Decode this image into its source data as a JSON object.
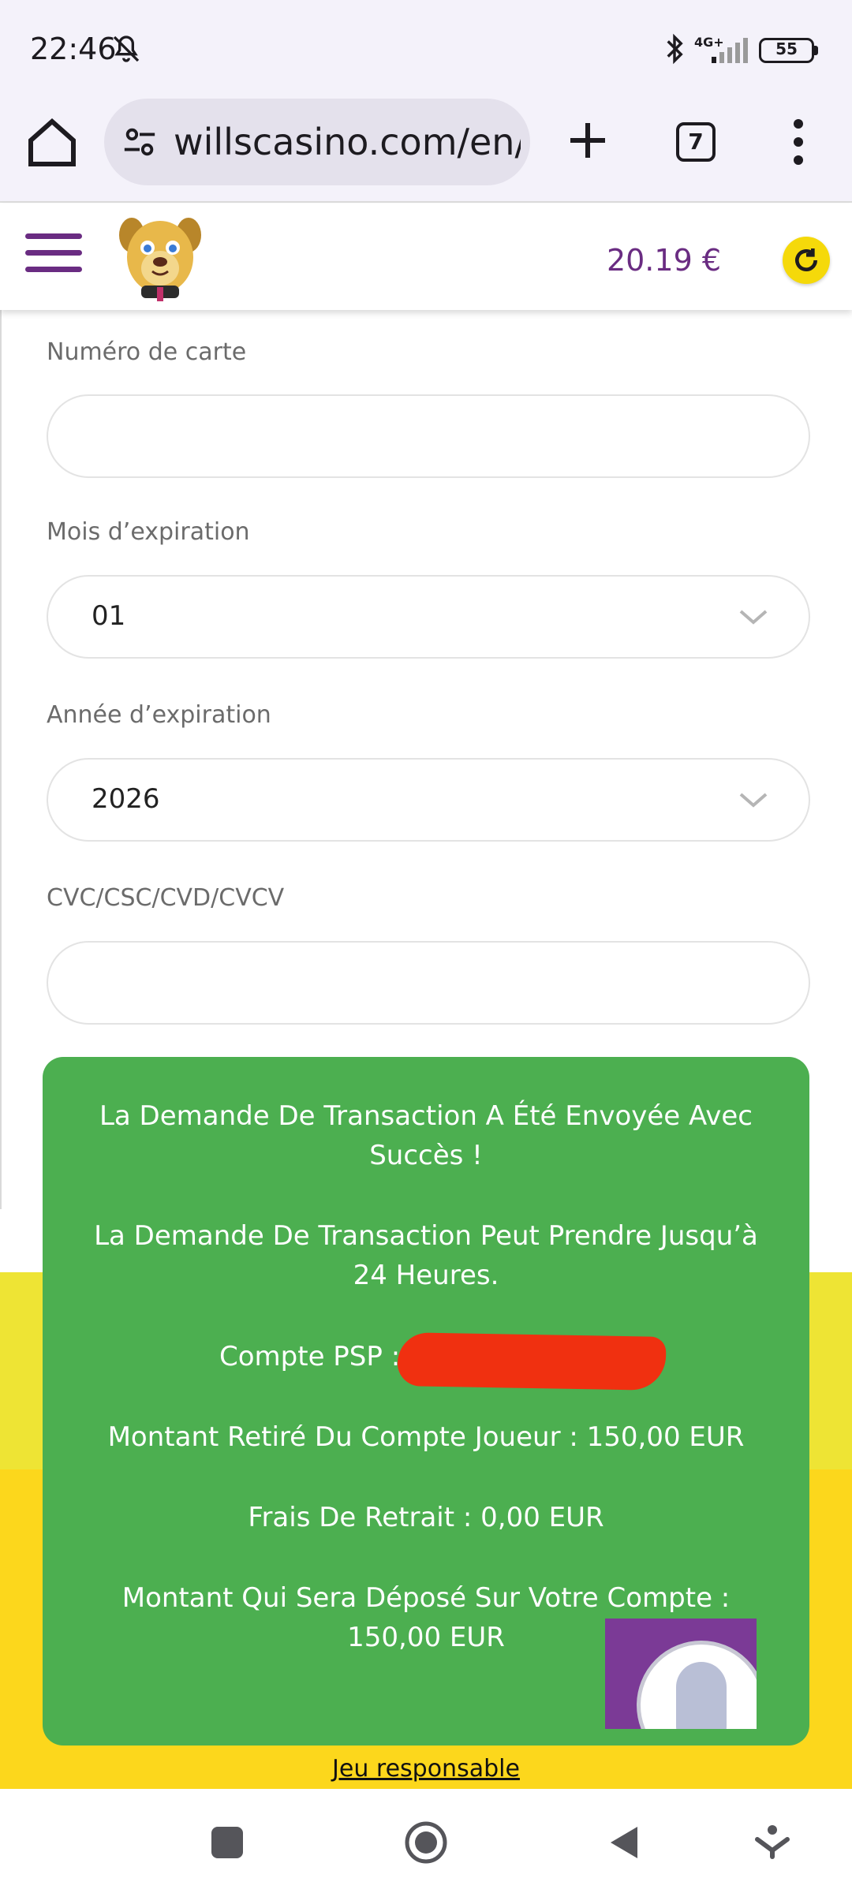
{
  "status_bar": {
    "time": "22:46",
    "network": "4G+",
    "battery": "55",
    "icons": [
      "bell-off-icon",
      "bluetooth-icon",
      "signal-icon",
      "battery-icon"
    ]
  },
  "browser": {
    "url": "willscasino.com/en/c",
    "tab_count": "7",
    "icons": [
      "home-icon",
      "site-settings-icon",
      "plus-icon",
      "more-vert-icon"
    ]
  },
  "header": {
    "balance": "20.19 €",
    "icons": [
      "hamburger-icon",
      "dog-logo",
      "refresh-icon"
    ],
    "colors": {
      "brand_purple": "#6a2c82",
      "refresh_yellow": "#f5d90a"
    }
  },
  "form": {
    "card_number": {
      "label": "Numéro de carte",
      "value": ""
    },
    "expiry_month": {
      "label": "Mois d’expiration",
      "value": "01"
    },
    "expiry_year": {
      "label": "Année d’expiration",
      "value": "2026"
    },
    "cvc": {
      "label": "CVC/CSC/CVD/CVCV",
      "value": ""
    }
  },
  "popup": {
    "line1": "La Demande De Transaction A Été Envoyée Avec Succès !",
    "line2": "La Demande De Transaction Peut Prendre Jusqu’à 24 Heures.",
    "psp_label": "Compte PSP :",
    "withdrawn": "Montant Retiré Du Compte Joueur : 150,00 EUR",
    "fees": "Frais De Retrait : 0,00 EUR",
    "deposit": "Montant Qui Sera Déposé Sur Votre Compte : 150,00 EUR",
    "color": "#4caf50"
  },
  "footer": {
    "responsible_link": "Jeu responsable",
    "colors": {
      "top": "#eee434",
      "bottom": "#fcd71c"
    }
  }
}
